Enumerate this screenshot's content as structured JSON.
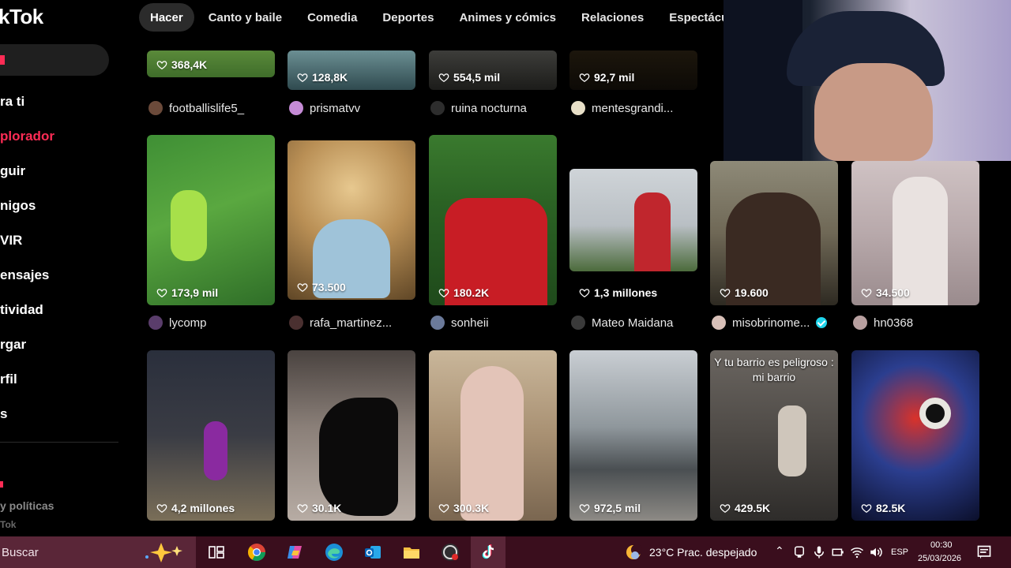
{
  "sidebar": {
    "logo": "kTok",
    "items": [
      {
        "label": "ra ti",
        "active": false
      },
      {
        "label": "plorador",
        "active": true
      },
      {
        "label": "guir",
        "active": false
      },
      {
        "label": "nigos",
        "active": false
      },
      {
        "label": "VIR",
        "active": false
      },
      {
        "label": "ensajes",
        "active": false
      },
      {
        "label": "tividad",
        "active": false
      },
      {
        "label": "rgar",
        "active": false
      },
      {
        "label": "rfil",
        "active": false
      },
      {
        "label": "s",
        "active": false
      }
    ],
    "footer_policies": "y políticas",
    "footer_brand": "Tok"
  },
  "categories": [
    "Hacer",
    "Canto y baile",
    "Comedia",
    "Deportes",
    "Animes y cómics",
    "Relaciones",
    "Espectáculos"
  ],
  "rows": [
    {
      "cards": [
        {
          "likes": "368,4K",
          "author": "footballislife5_"
        },
        {
          "likes": "128,8K",
          "author": "prismatvv"
        },
        {
          "likes": "554,5 mil",
          "author": "ruina nocturna"
        },
        {
          "likes": "92,7 mil",
          "author": "mentesgrandi..."
        }
      ]
    },
    {
      "cards": [
        {
          "likes": "173,9 mil",
          "author": "lycomp"
        },
        {
          "likes": "73.500",
          "author": "rafa_martinez..."
        },
        {
          "likes": "180.2K",
          "author": "sonheii"
        },
        {
          "likes": "1,3 millones",
          "author": "Mateo Maidana"
        },
        {
          "likes": "19.600",
          "author": "misobrinome..."
        },
        {
          "likes": "34.500",
          "author": "hn0368"
        }
      ]
    },
    {
      "cards": [
        {
          "likes": "4,2 millones",
          "author": ""
        },
        {
          "likes": "30.1K",
          "author": ""
        },
        {
          "likes": "300.3K",
          "author": ""
        },
        {
          "likes": "972,5 mil",
          "author": ""
        },
        {
          "likes": "429.5K",
          "author": "",
          "caption": "Y tu barrio es peligroso : mi barrio"
        },
        {
          "likes": "82.5K",
          "author": ""
        }
      ]
    }
  ],
  "taskbar": {
    "search_placeholder": "Buscar",
    "weather": "23°C  Prac. despejado",
    "language": "ESP",
    "time": "00:30",
    "date": "25/03/2026"
  },
  "colors": {
    "accent": "#fe2c55",
    "verified": "#20d5ec",
    "taskbar": "#3a0e1d"
  }
}
